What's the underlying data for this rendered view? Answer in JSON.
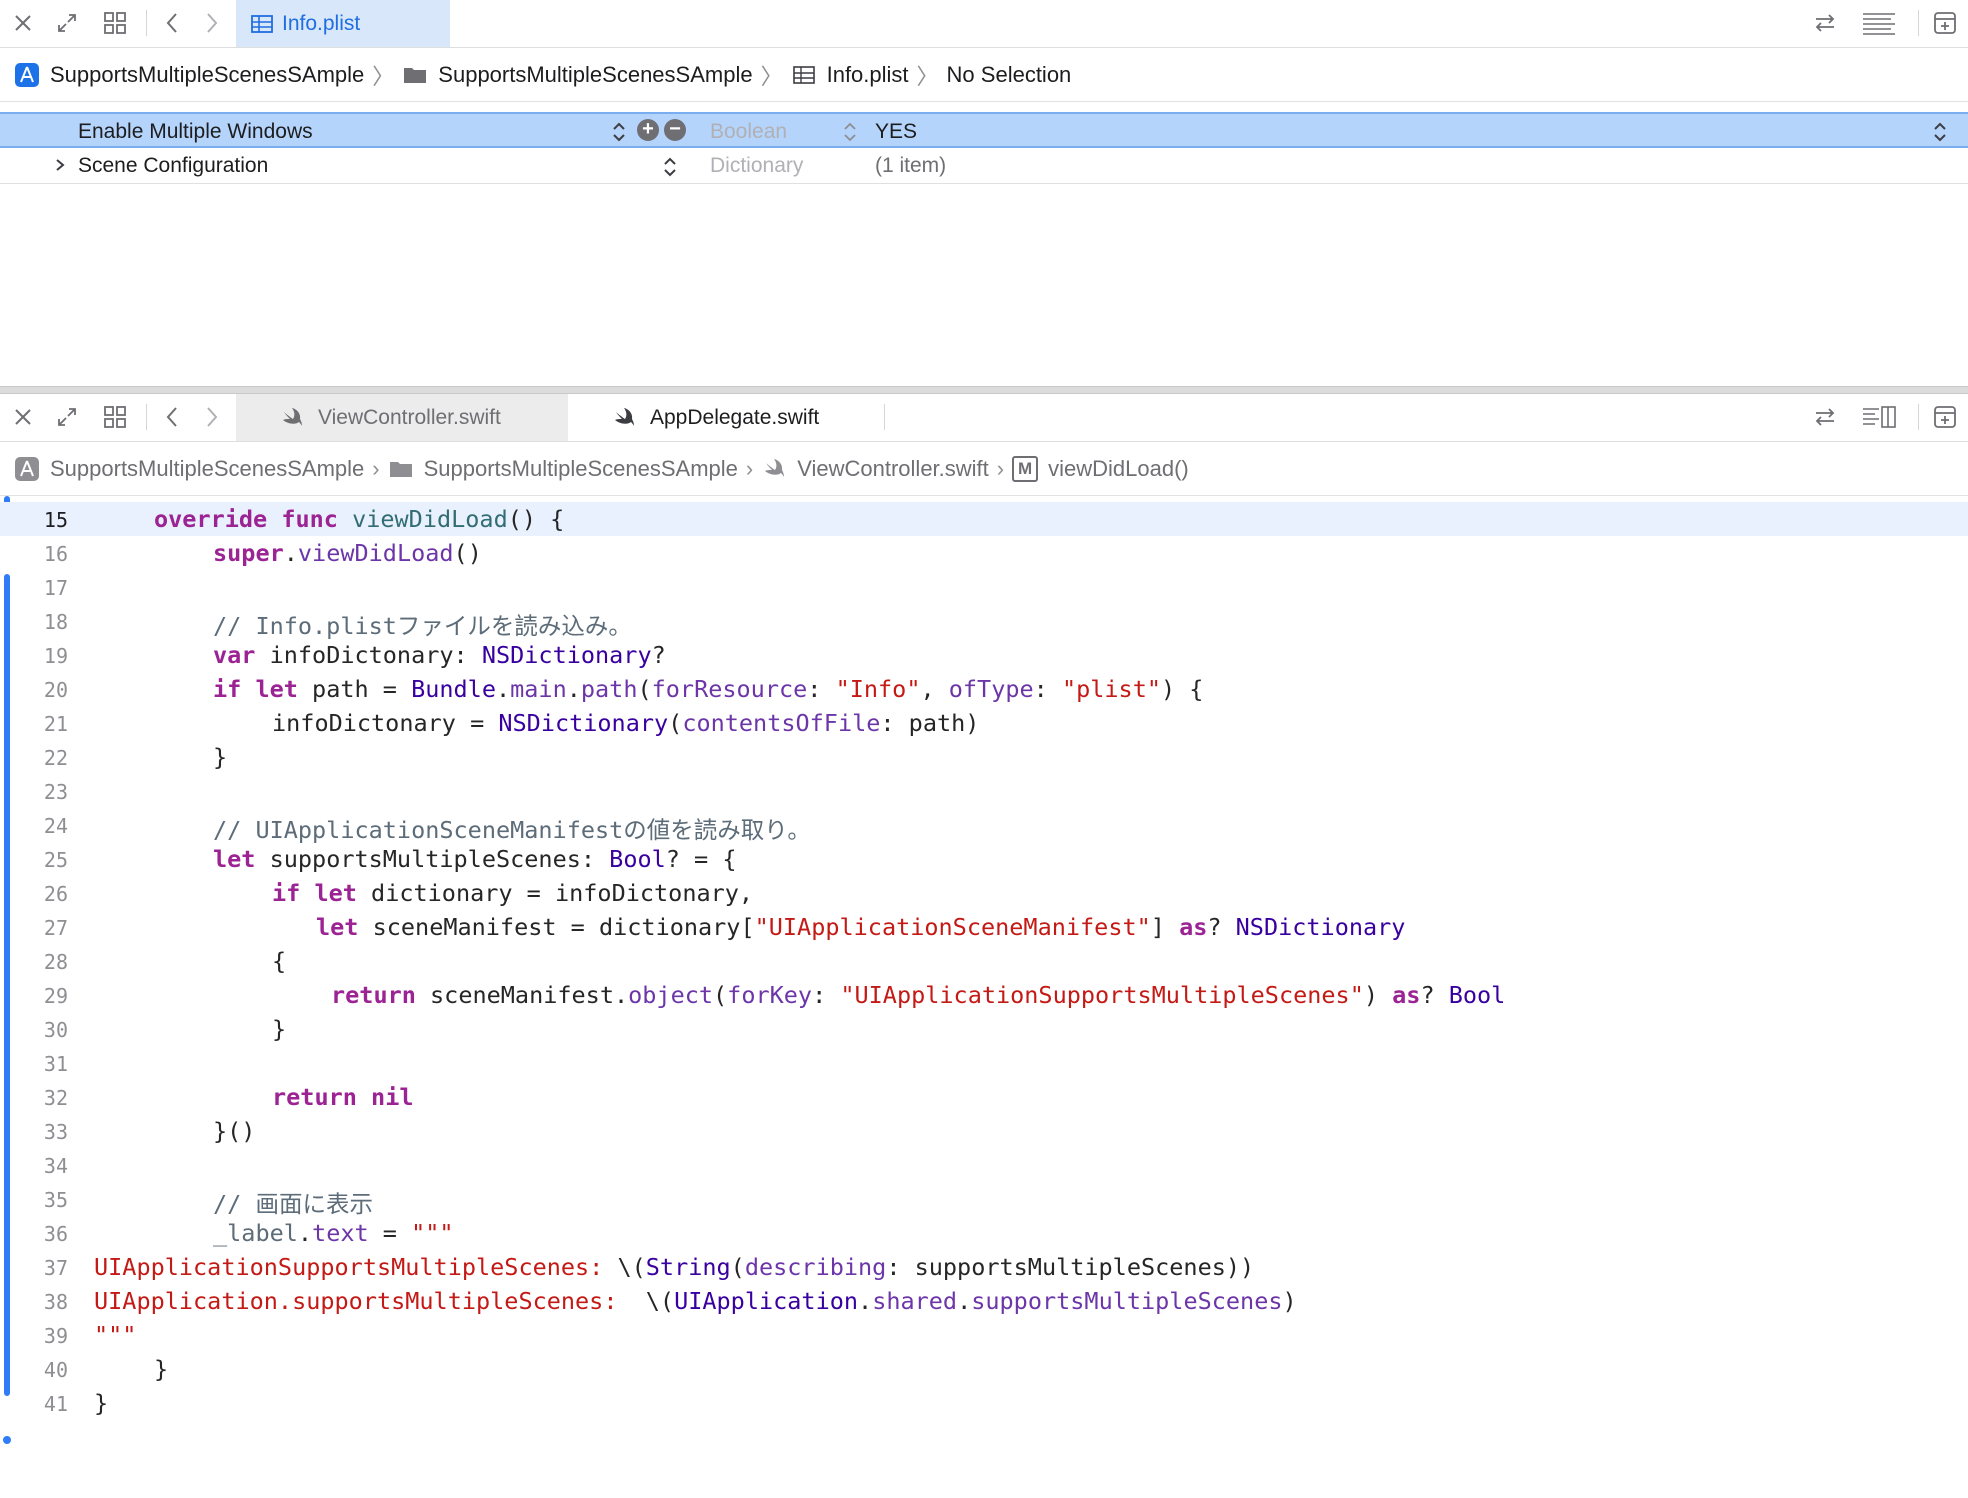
{
  "top_editor": {
    "tab": {
      "label": "Info.plist",
      "icon": "table-icon"
    },
    "breadcrumb": [
      "SupportsMultipleScenesSAmple",
      "SupportsMultipleScenesSAmple",
      "Info.plist",
      "No Selection"
    ],
    "rows": [
      {
        "key": "Enable Multiple Windows",
        "type": "Boolean",
        "value": "YES",
        "selected": true
      },
      {
        "key": "Scene Configuration",
        "type": "Dictionary",
        "value": "(1 item)",
        "selected": false
      }
    ]
  },
  "bottom_editor": {
    "tabs": [
      {
        "label": "ViewController.swift",
        "icon": "swift-icon",
        "active": true
      },
      {
        "label": "AppDelegate.swift",
        "icon": "swift-icon",
        "active": false
      }
    ],
    "breadcrumb": [
      "SupportsMultipleScenesSAmple",
      "SupportsMultipleScenesSAmple",
      "ViewController.swift",
      "viewDidLoad()"
    ],
    "method_badge": "M",
    "current_line": "15",
    "line_numbers": [
      "15",
      "16",
      "17",
      "18",
      "19",
      "20",
      "21",
      "22",
      "23",
      "24",
      "25",
      "26",
      "27",
      "28",
      "29",
      "30",
      "31",
      "32",
      "33",
      "34",
      "35",
      "36",
      "37",
      "38",
      "39",
      "40",
      "41"
    ],
    "code": {
      "l15": {
        "kw1": "override",
        "kw2": "func",
        "name": "viewDidLoad",
        "rest": "() {"
      },
      "l16": {
        "kw": "super",
        "dot": ".",
        "method": "viewDidLoad",
        "rest": "()"
      },
      "l18": "// Info.plistファイルを読み込み。",
      "l19": {
        "kw": "var",
        "name": " infoDictonary: ",
        "type": "NSDictionary",
        "rest": "?"
      },
      "l20": {
        "kw1": "if",
        "kw2": "let",
        "a": " path = ",
        "type": "Bundle",
        "b": ".",
        "prop": "main",
        "c": ".",
        "method": "path",
        "d": "(",
        "label1": "forResource",
        "e": ": ",
        "str1": "\"Info\"",
        "f": ", ",
        "label2": "ofType",
        "g": ": ",
        "str2": "\"plist\"",
        "h": ") {"
      },
      "l21": {
        "a": "infoDictonary = ",
        "type": "NSDictionary",
        "b": "(",
        "label": "contentsOfFile",
        "c": ": path)"
      },
      "l22": "}",
      "l24": "// UIApplicationSceneManifestの値を読み取り。",
      "l25": {
        "kw": "let",
        "a": " supportsMultipleScenes: ",
        "type": "Bool",
        "b": "? = {"
      },
      "l26": {
        "kw1": "if",
        "kw2": "let",
        "a": " dictionary = infoDictonary,"
      },
      "l27": {
        "kw": "let",
        "a": " sceneManifest = dictionary[",
        "str": "\"UIApplicationSceneManifest\"",
        "b": "] ",
        "kw2": "as",
        "c": "? ",
        "type": "NSDictionary"
      },
      "l28": "{",
      "l29": {
        "kw": "return",
        "a": " sceneManifest.",
        "method": "object",
        "b": "(",
        "label": "forKey",
        "c": ": ",
        "str": "\"UIApplicationSupportsMultipleScenes\"",
        "d": ") ",
        "kw2": "as",
        "e": "? ",
        "type": "Bool"
      },
      "l30": "}",
      "l32": {
        "kw1": "return",
        "kw2": "nil"
      },
      "l33": "}()",
      "l35": "// 画面に表示",
      "l36": {
        "a": "_label",
        "b": ".",
        "prop": "text",
        "c": " = ",
        "str": "\"\"\""
      },
      "l37": {
        "str": "UIApplicationSupportsMultipleScenes: ",
        "a": "\\(",
        "type": "String",
        "b": "(",
        "label": "describing",
        "c": ": supportsMultipleScenes))"
      },
      "l38": {
        "str": "UIApplication.supportsMultipleScenes: ",
        "a": " \\(",
        "type": "UIApplication",
        "b": ".",
        "prop1": "shared",
        "c": ".",
        "prop2": "supportsMultipleScenes",
        "d": ")"
      },
      "l39": "\"\"\"",
      "l40": "}",
      "l41": "}"
    }
  },
  "colors": {
    "selection": "#b4d4fb",
    "keyword": "#9b2393",
    "type": "#3900a0",
    "string": "#c41a16",
    "comment": "#5d6c79",
    "change_bar": "#2f7cf6"
  }
}
